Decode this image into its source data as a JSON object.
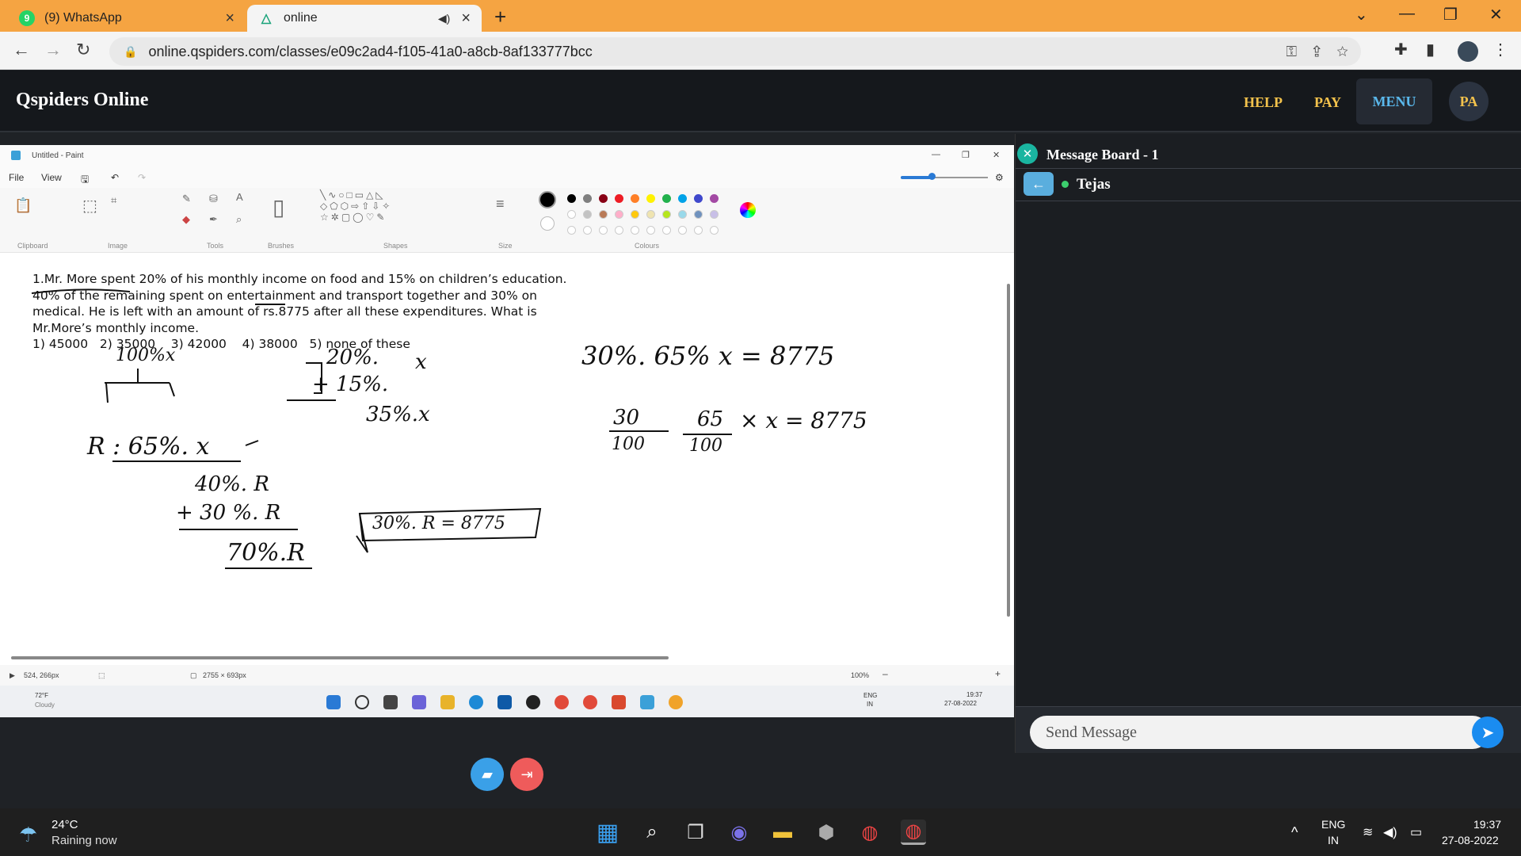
{
  "browser": {
    "tabs": [
      {
        "title": "(9) WhatsApp",
        "badge": "9",
        "active": false
      },
      {
        "title": "online",
        "active": true
      }
    ],
    "url": "online.qspiders.com/classes/e09c2ad4-f105-41a0-a8cb-8af133777bcc"
  },
  "app": {
    "brand": "Qspiders Online",
    "nav": {
      "help": "HELP",
      "pay": "PAY",
      "menu": "MENU"
    },
    "avatar": "PA",
    "accent": "#f3c24c",
    "menu_color": "#5ab8ec"
  },
  "paint": {
    "window_title": "Untitled - Paint",
    "menu": {
      "file": "File",
      "view": "View"
    },
    "groups": [
      "Clipboard",
      "Image",
      "Tools",
      "Brushes",
      "Shapes",
      "Size",
      "Colours"
    ],
    "question": {
      "lines": [
        "1.Mr. More spent 20% of his monthly income on food and 15% on children’s education.",
        "40% of the remaining spent on entertainment and transport together and 30% on",
        "medical. He is left with an amount of rs.8775 after all these expenditures. What is",
        "Mr.More’s monthly income.",
        "1) 45000   2) 35000    3) 42000    4) 38000   5) none of these"
      ]
    },
    "handwriting": {
      "h1": "100%x",
      "h2": "20%.",
      "h3": "+ 15%.",
      "h4": "35%.x",
      "h5": "R : 65%. x",
      "h6": "40%. R",
      "h7": "+ 30 %. R",
      "h8": "70%.R",
      "h9": "30%. R = 8775",
      "h10": "30%. 65% x = 8775",
      "h11_num": "30",
      "h11_den": "100",
      "h12_num": "65",
      "h12_den": "100",
      "h13": "× x = 8775"
    },
    "status": {
      "cursor": "524, 266px",
      "canvas_size": "2755 × 693px",
      "zoom": "100%",
      "zoom_level_fraction": 0.35
    },
    "inner_taskbar": {
      "temp": "72°F",
      "cond": "Cloudy",
      "lang1": "ENG",
      "lang2": "IN",
      "time": "19:37",
      "date": "27-08-2022"
    }
  },
  "board": {
    "title": "Message Board - 1",
    "user": "Tejas",
    "placeholder": "Send Message"
  },
  "taskbar": {
    "temp": "24°C",
    "condition": "Raining now",
    "lang1": "ENG",
    "lang2": "IN",
    "time": "19:37",
    "date": "27-08-2022"
  }
}
